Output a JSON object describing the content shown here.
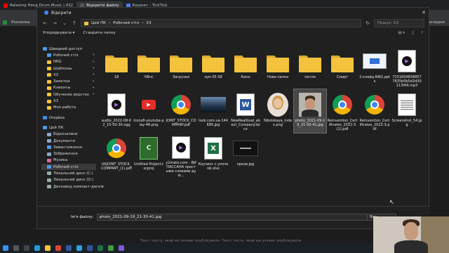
{
  "browser": {
    "tabs": [
      {
        "label": "Relaxing Hang Drum Music | 432",
        "color": "#ff0000"
      },
      {
        "label": "Відкрити файлу",
        "color": "#444"
      },
      {
        "label": "Кошнет - TickTick",
        "color": "#4a7cff"
      }
    ],
    "bookmarks": [
      {
        "label": "Розсилка"
      },
      {
        "label": "закладки"
      }
    ]
  },
  "dialog": {
    "title": "Відкрити",
    "close": "✕",
    "breadcrumb": [
      "Цей ПК",
      "Робочий стіл",
      "Х3"
    ],
    "search_placeholder": "Пошук: Х3",
    "commands": {
      "organize": "Упорядкувати ▾",
      "new_folder": "Створити папку"
    },
    "sidebar": [
      {
        "label": "Швидкий доступ",
        "level": 0,
        "color": "#4a9be8"
      },
      {
        "label": "Робочий стіл",
        "level": 1,
        "color": "#4a9be8",
        "pin": true
      },
      {
        "label": "NRG",
        "level": 1,
        "color": "#f3c33d",
        "pin": true
      },
      {
        "label": "Шаблоны",
        "level": 1,
        "color": "#f3c33d",
        "pin": true
      },
      {
        "label": "Х3",
        "level": 1,
        "color": "#f3c33d",
        "pin": true
      },
      {
        "label": "Заметки",
        "level": 1,
        "color": "#f3c33d",
        "pin": true
      },
      {
        "label": "Клиенты",
        "level": 1,
        "color": "#f3c33d",
        "pin": true
      },
      {
        "label": "Обучение верстке",
        "level": 1,
        "color": "#f3c33d",
        "pin": true
      },
      {
        "label": "Х3",
        "level": 1,
        "color": "#f3c33d"
      },
      {
        "label": "Моя работа",
        "level": 1,
        "color": "#f3c33d"
      },
      {
        "label": "",
        "level": -1
      },
      {
        "label": "Dropbox",
        "level": 0,
        "color": "#3d8ce0"
      },
      {
        "label": "",
        "level": -1
      },
      {
        "label": "Цей ПК",
        "level": 0,
        "color": "#4a9be8"
      },
      {
        "label": "Відеозаписи",
        "level": 1,
        "color": "#8aa6c8"
      },
      {
        "label": "Документи",
        "level": 1,
        "color": "#8aa6c8"
      },
      {
        "label": "Завантаження",
        "level": 1,
        "color": "#4a9be8"
      },
      {
        "label": "Зображення",
        "level": 1,
        "color": "#8aa6c8"
      },
      {
        "label": "Музика",
        "level": 1,
        "color": "#d86b9a"
      },
      {
        "label": "Робочий стіл",
        "level": 1,
        "color": "#4a9be8",
        "selected": true
      },
      {
        "label": "Локальний диск (C:)",
        "level": 1,
        "color": "#9aa"
      },
      {
        "label": "Локальний диск (D:)",
        "level": 1,
        "color": "#9aa"
      },
      {
        "label": "Дисковод компакт-дисків",
        "level": 1,
        "color": "#9aa"
      }
    ],
    "files": [
      {
        "name": "18",
        "type": "folder"
      },
      {
        "name": "ЧФчс",
        "type": "folder"
      },
      {
        "name": "Загрузки",
        "type": "folder"
      },
      {
        "name": "зум 05 08",
        "type": "folder"
      },
      {
        "name": "Кино",
        "type": "folder"
      },
      {
        "name": "Нова папка",
        "type": "folder"
      },
      {
        "name": "петля",
        "type": "folder"
      },
      {
        "name": "Смарт",
        "type": "folder"
      },
      {
        "name": "2-клайд-NRG.pptx",
        "type": "ppt"
      },
      {
        "name": "71516048368577825b0b5d2d30113f49.mp3",
        "type": "media"
      },
      {
        "name": "audio_2022-08-02_15-50-30.ogg",
        "type": "media"
      },
      {
        "name": "icons8-youtube-play-48.png",
        "type": "youtube"
      },
      {
        "name": "JOINT_STOCK_COMPANY.pdf",
        "type": "chrome"
      },
      {
        "name": "look.com.ua-144695.jpg",
        "type": "photo-landscape"
      },
      {
        "name": "NewRealGoal_about_Company.docx",
        "type": "word"
      },
      {
        "name": "Nikolskaya_index.png",
        "type": "portrait-woman"
      },
      {
        "name": "photo_2021-09-19_21-30-41.jpg",
        "type": "portrait-man",
        "selected": true
      },
      {
        "name": "Reinvention_Certificates_2022-3(1).pdf",
        "type": "chrome"
      },
      {
        "name": "Reinvention_Certificates_2022-3.pdf",
        "type": "chrome"
      },
      {
        "name": "Screenshot_54.jpg",
        "type": "document"
      },
      {
        "name": "UKJOINT_STOCK_COMPANY_(1).pdf",
        "type": "chrome"
      },
      {
        "name": "Untitled Project.tscproj",
        "type": "camtasia"
      },
      {
        "name": "y2mate.com - ВИПАССАНА простыми словами дую...",
        "type": "media"
      },
      {
        "name": "Коучинг с упочкой.xlsx",
        "type": "excel"
      },
      {
        "name": "презв.jpg",
        "type": "dark-image"
      }
    ],
    "footer": {
      "file_name_label": "Ім'я файлу:",
      "file_name_value": "photo_2021-09-19_21-30-41.jpg",
      "filter_value": "Все"
    }
  },
  "background_text": "Текст поста, який ми хочемо опублікувати.  Текст поста, який ми хочемо опублікувати."
}
